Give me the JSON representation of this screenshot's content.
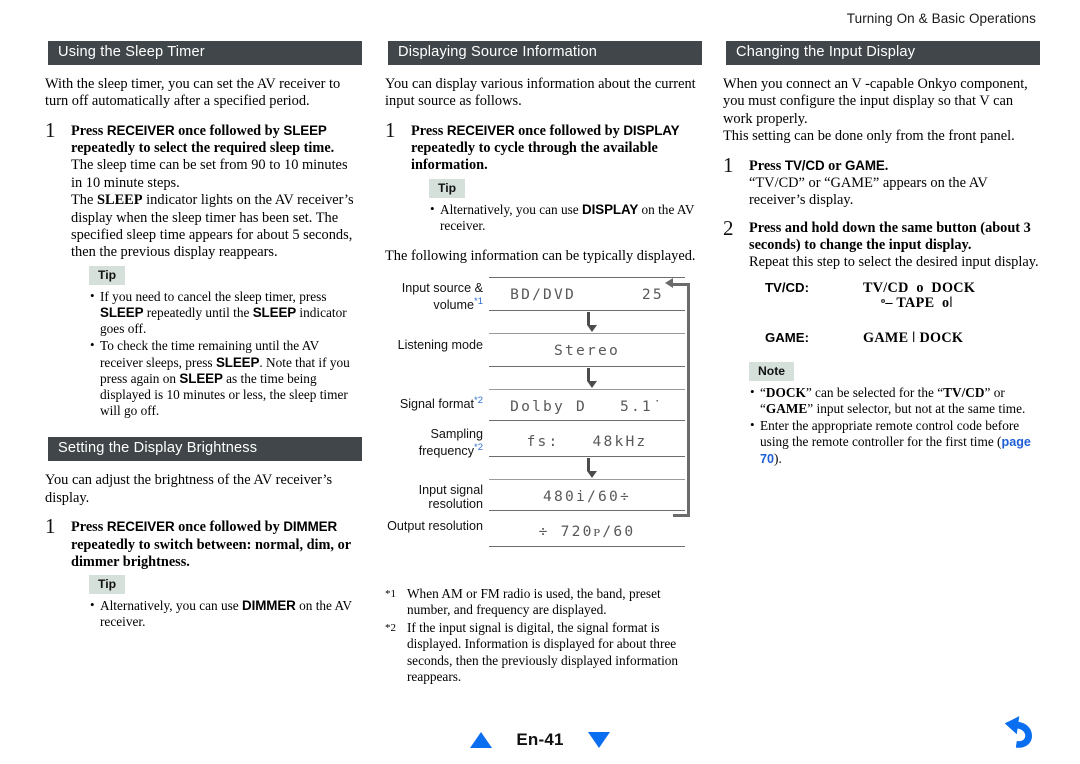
{
  "header": {
    "running_title": "Turning On & Basic Operations"
  },
  "column_left": {
    "section1": {
      "title": "Using the Sleep Timer",
      "intro": "With the sleep timer, you can set the AV receiver to turn off automatically after a specified period.",
      "step_number": "1",
      "step_title_parts": {
        "a": "Press ",
        "kw1": "RECEIVER",
        "b": " once followed by ",
        "kw2": "SLEEP",
        "c": " repeatedly to select the required sleep time."
      },
      "step_body_1": "The sleep time can be set from 90 to 10 minutes in 10 minute steps.",
      "step_body_2_a": "The ",
      "step_body_2_kw": "SLEEP",
      "step_body_2_b": " indicator lights on the AV receiver’s display when the sleep timer has been set. The specified sleep time appears for about 5 seconds, then the previous display reappears.",
      "tip_label": "Tip",
      "tip_bullets": [
        {
          "a": "If you need to cancel the sleep timer, press ",
          "kw1": "SLEEP",
          "b": " repeatedly until the ",
          "kw2": "SLEEP",
          "c": " indicator goes off."
        },
        {
          "a": "To check the time remaining until the AV receiver sleeps, press ",
          "kw1": "SLEEP",
          "b": ". Note that if you press again on ",
          "kw2": "SLEEP",
          "c": " as the time being displayed is 10 minutes or less, the sleep timer will go off."
        }
      ]
    },
    "section2": {
      "title": "Setting the Display Brightness",
      "intro": "You can adjust the brightness of the AV receiver’s display.",
      "step_number": "1",
      "step_title_parts": {
        "a": "Press ",
        "kw1": "RECEIVER",
        "b": " once followed by ",
        "kw2": "DIMMER",
        "c": " repeatedly to switch between: normal, dim, or dimmer brightness."
      },
      "tip_label": "Tip",
      "tip_bullet": {
        "a": "Alternatively, you can use ",
        "kw1": "DIMMER",
        "b": " on the AV receiver."
      }
    }
  },
  "column_middle": {
    "section": {
      "title": "Displaying Source Information",
      "intro": "You can display various information about the current input source as follows.",
      "step_number": "1",
      "step_title_parts": {
        "a": "Press ",
        "kw1": "RECEIVER",
        "b": " once followed by ",
        "kw2": "DISPLAY",
        "c": " repeatedly to cycle through the available information."
      },
      "tip_label": "Tip",
      "tip_bullet": {
        "a": "Alternatively, you can use ",
        "kw1": "DISPLAY",
        "b": " on the AV receiver."
      },
      "after_tip": "The following information can be typically displayed."
    },
    "diagram": {
      "rows": [
        {
          "label_line1": "Input source &",
          "label_line2": "volume",
          "ref": "*1",
          "lcd": "BD/DVD      25"
        },
        {
          "label_line1": "Listening mode",
          "label_line2": "",
          "ref": "",
          "lcd": "Stereo"
        },
        {
          "label_line1": "Signal format",
          "label_line2": "",
          "ref": "*2",
          "lcd": "Dolby D   5.1˙"
        },
        {
          "label_line1": "Sampling",
          "label_line2": "frequency",
          "ref": "*2",
          "lcd": "fs:   48kHz"
        },
        {
          "label_line1": "Input signal",
          "label_line2": "resolution",
          "ref": "",
          "lcd": "480i/60÷"
        },
        {
          "label_line1": "Output resolution",
          "label_line2": "",
          "ref": "",
          "lcd": "÷ 720ᴘ/60"
        }
      ]
    },
    "footnotes": [
      {
        "mark": "*1",
        "text": "When AM or FM radio is used, the band, preset number, and frequency are displayed."
      },
      {
        "mark": "*2",
        "text": "If the input signal is digital, the signal format is displayed. Information is displayed for about three seconds, then the previously displayed information reappears."
      }
    ]
  },
  "column_right": {
    "section": {
      "title": "Changing the Input Display",
      "intro_a": "When you connect an ",
      "intro_logo1": "V",
      "intro_b": " -capable Onkyo component, you must configure the input display so that ",
      "intro_logo2": "V",
      "intro_c": "  can work properly.",
      "intro2": "This setting can be done only from the front panel.",
      "step1": {
        "number": "1",
        "title_a": "Press ",
        "title_kw1": "TV/CD",
        "title_b": " or ",
        "title_kw2": "GAME",
        "title_c": ".",
        "body": "“TV/CD” or “GAME” appears on the AV receiver’s display."
      },
      "step2": {
        "number": "2",
        "title": "Press and hold down the same button (about 3 seconds) to change the input display.",
        "body": "Repeat this step to select the desired input display."
      },
      "cycles": [
        {
          "key": "TV/CD:",
          "line1": "TV/CD  о  DOCK",
          "line2": "ᵒ– TAPE  оǀ"
        },
        {
          "key": "GAME:",
          "line1": "GAME ǀ DOCK",
          "line2": ""
        }
      ],
      "note_label": "Note",
      "note_bullets": [
        {
          "a": "“",
          "kw1": "DOCK",
          "b": "” can be selected for the “",
          "kw2": "TV/CD",
          "c": "” or “",
          "kw3": "GAME",
          "d": "” input selector, but not at the same time."
        }
      ],
      "note_bullet2_a": "Enter the appropriate remote control code before using the remote controller for the first time (",
      "note_bullet2_link": "page 70",
      "note_bullet2_b": ")."
    }
  },
  "footer": {
    "page_label": "En-41",
    "prev_icon": "triangle-up-icon",
    "next_icon": "triangle-down-icon",
    "back_icon": "back-arrow-icon"
  }
}
